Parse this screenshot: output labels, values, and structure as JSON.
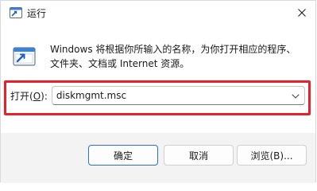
{
  "window": {
    "title": "运行"
  },
  "description": {
    "line1": "Windows 将根据你所输入的名称，为你打开相应的程序、",
    "line2": "文件夹、文档或 Internet 资源。"
  },
  "open_field": {
    "label_prefix": "打开(",
    "label_accel": "O",
    "label_suffix": "):",
    "value": "diskmgmt.msc"
  },
  "buttons": {
    "ok": "确定",
    "cancel": "取消",
    "browse": "浏览(B)..."
  },
  "colors": {
    "highlight": "#e8202a",
    "primary_border": "#2f6fc4",
    "footer_bg": "#f3f3f3"
  },
  "icons": {
    "title": "run-icon",
    "close": "close-icon",
    "dialog": "run-dialog-icon",
    "dropdown": "chevron-down-icon"
  }
}
